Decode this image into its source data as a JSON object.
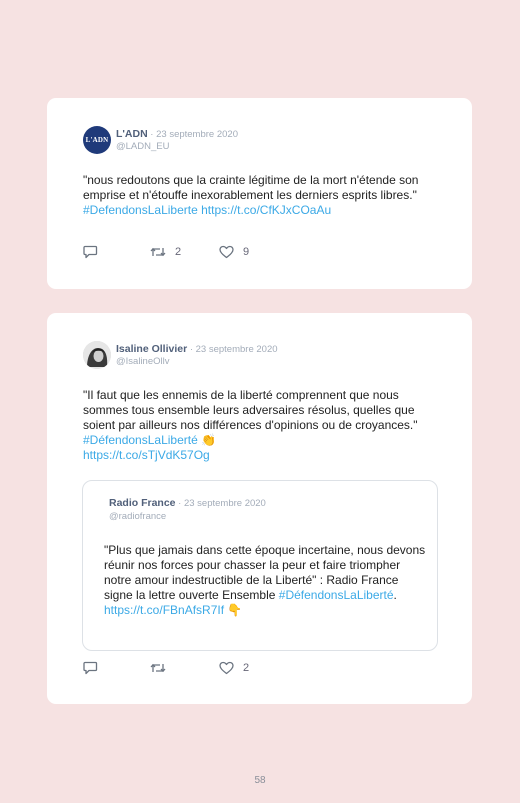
{
  "tweets": [
    {
      "avatar_text": "L'ADN",
      "author": "L'ADN",
      "date": " · 23 septembre 2020",
      "handle": "@LADN_EU",
      "text_prefix": "\"nous redoutons que la crainte légitime de la mort n'étende son emprise et n'étouffe inexorablement les derniers esprits libres.\" ",
      "hashtag": "#DefendonsLaLiberte",
      "url": "https://t.co/CfKJxCOaAu",
      "retweets": "2",
      "likes": "9"
    },
    {
      "author": "Isaline Ollivier",
      "date": " · 23 septembre 2020",
      "handle": "@IsalineOllv",
      "text_prefix": "\"Il faut que les ennemis de la liberté comprennent que nous sommes tous ensemble leurs adversaires résolus, quelles que soient par ailleurs nos différences d'opinions ou de croyances.\" ",
      "hashtag": "#DéfendonsLaLiberté",
      "emoji": "👏",
      "url": "https://t.co/sTjVdK57Og",
      "retweets": "",
      "likes": "2",
      "quote": {
        "author": "Radio France",
        "date": " · 23 septembre 2020",
        "handle": "@radiofrance",
        "text_prefix": "\"Plus que jamais dans cette époque incertaine, nous devons réunir nos forces pour chasser la peur et faire triompher notre amour indestructible de la Liberté\" : Radio France signe la lettre ouverte Ensemble ",
        "hashtag": "#DéfendonsLaLiberté",
        "after_hashtag": ".",
        "url": "https://t.co/FBnAfsR7If",
        "emoji": "👇"
      }
    }
  ],
  "page_number": "58",
  "colors": {
    "background": "#f6e2e2",
    "link": "#3ba9e6",
    "avatar_ladn": "#1f3a7a"
  },
  "icons": [
    "reply-icon",
    "retweet-icon",
    "like-icon"
  ]
}
